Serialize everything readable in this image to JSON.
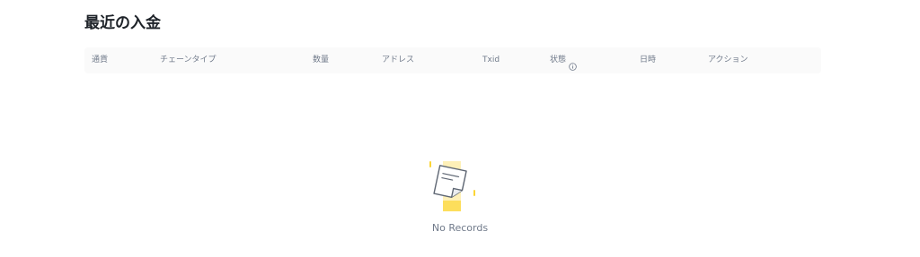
{
  "section": {
    "title": "最近の入金"
  },
  "table": {
    "columns": [
      "通貨",
      "チェーンタイプ",
      "数量",
      "アドレス",
      "Txid",
      "状態",
      "日時",
      "アクション"
    ],
    "rows": []
  },
  "empty_state": {
    "icon": "empty-document-icon",
    "text": "No Records"
  },
  "colors": {
    "header_bg": "#fafafa",
    "header_text": "#707a8a",
    "accent": "#fcd535"
  }
}
